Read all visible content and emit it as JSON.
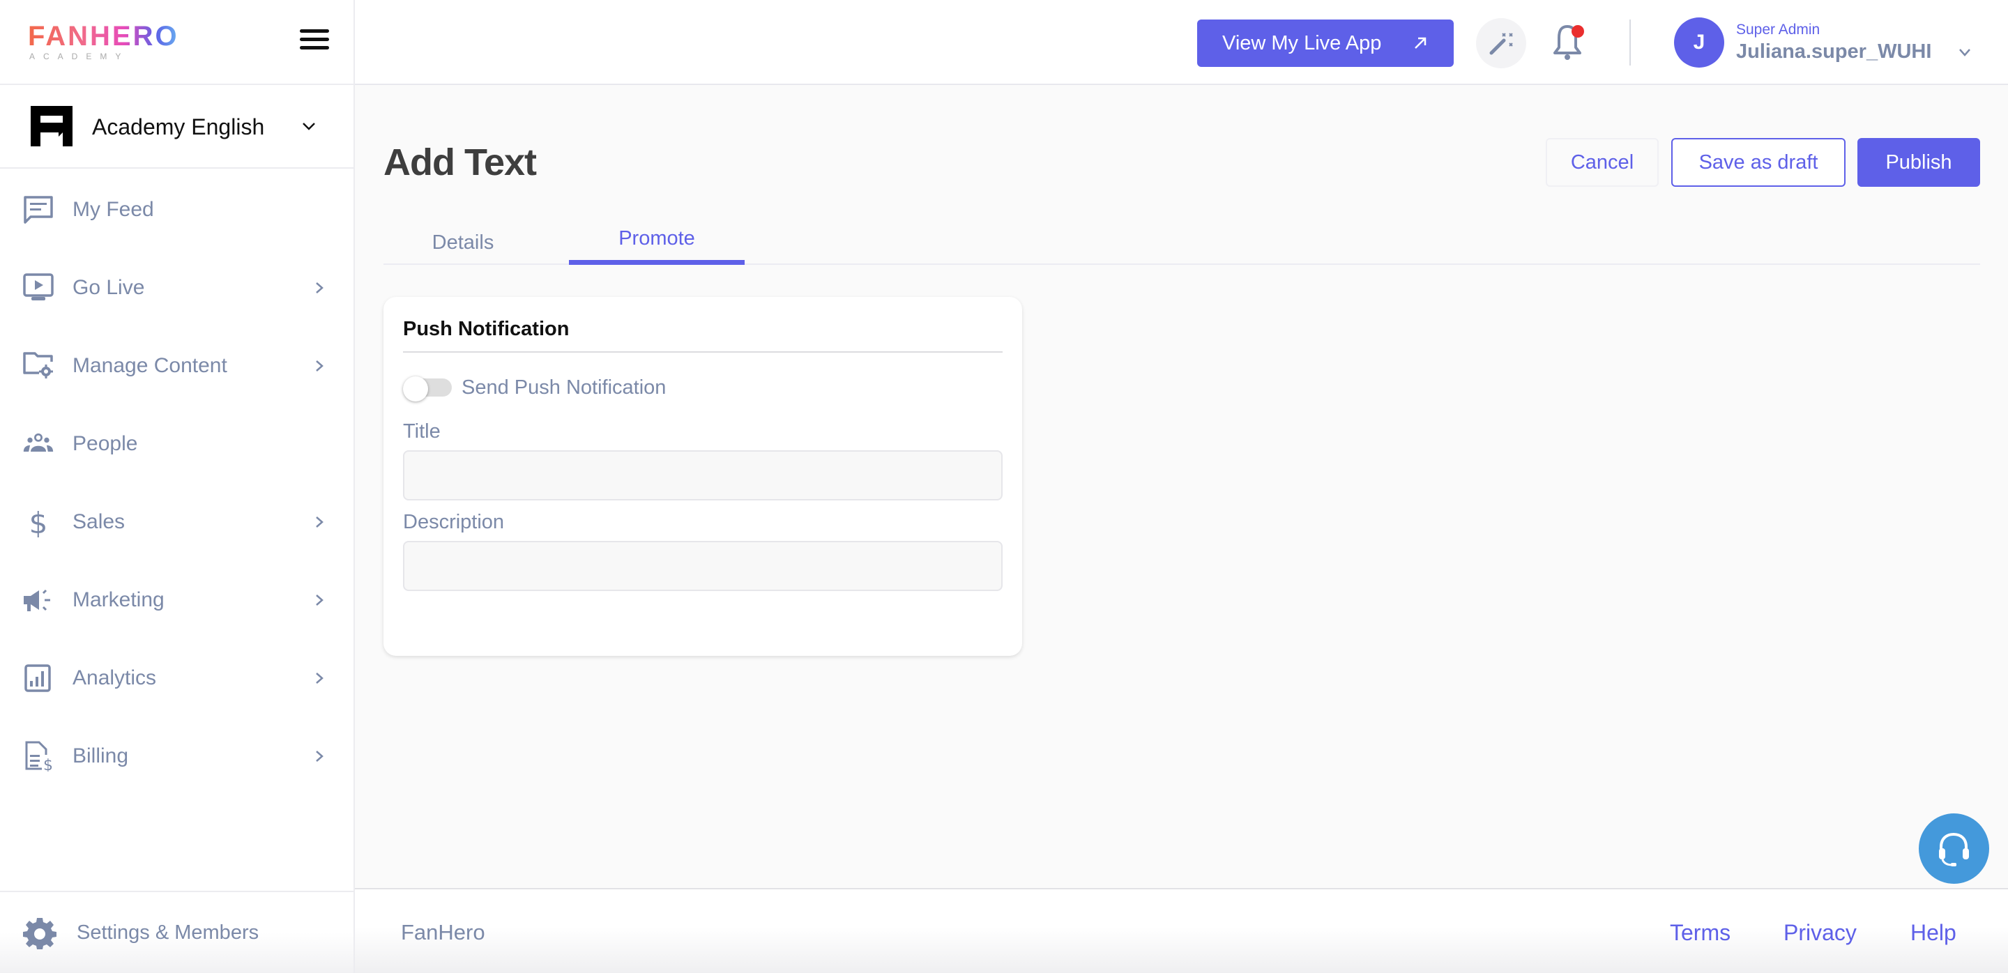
{
  "brand": {
    "logo_text": "FANHERO",
    "logo_subtext": "ACADEMY"
  },
  "org": {
    "name": "Academy English"
  },
  "sidebar": {
    "items": [
      {
        "label": "My Feed",
        "icon": "feed-icon",
        "has_submenu": false
      },
      {
        "label": "Go Live",
        "icon": "live-video-icon",
        "has_submenu": true
      },
      {
        "label": "Manage Content",
        "icon": "folder-settings-icon",
        "has_submenu": true
      },
      {
        "label": "People",
        "icon": "people-icon",
        "has_submenu": false
      },
      {
        "label": "Sales",
        "icon": "dollar-icon",
        "has_submenu": true
      },
      {
        "label": "Marketing",
        "icon": "megaphone-icon",
        "has_submenu": true
      },
      {
        "label": "Analytics",
        "icon": "analytics-icon",
        "has_submenu": true
      },
      {
        "label": "Billing",
        "icon": "billing-icon",
        "has_submenu": true
      }
    ],
    "settings_label": "Settings & Members"
  },
  "topbar": {
    "live_app_label": "View My Live App",
    "notifications_unread": true,
    "user": {
      "initial": "J",
      "role": "Super Admin",
      "name": "Juliana.super_WUHI"
    }
  },
  "page": {
    "title": "Add Text",
    "actions": {
      "cancel": "Cancel",
      "save_draft": "Save as draft",
      "publish": "Publish"
    },
    "tabs": [
      {
        "label": "Details",
        "active": false
      },
      {
        "label": "Promote",
        "active": true
      }
    ]
  },
  "push_card": {
    "title": "Push Notification",
    "toggle_label": "Send Push Notification",
    "toggle_on": false,
    "fields": [
      {
        "label": "Title",
        "value": "",
        "placeholder": ""
      },
      {
        "label": "Description",
        "value": "",
        "placeholder": ""
      }
    ]
  },
  "footer": {
    "brand": "FanHero",
    "links": [
      "Terms",
      "Privacy",
      "Help"
    ]
  },
  "colors": {
    "accent": "#5e60e8",
    "nav_text": "#7b89a8",
    "support_bubble": "#4499db",
    "notification_dot": "#ea2e2e"
  }
}
